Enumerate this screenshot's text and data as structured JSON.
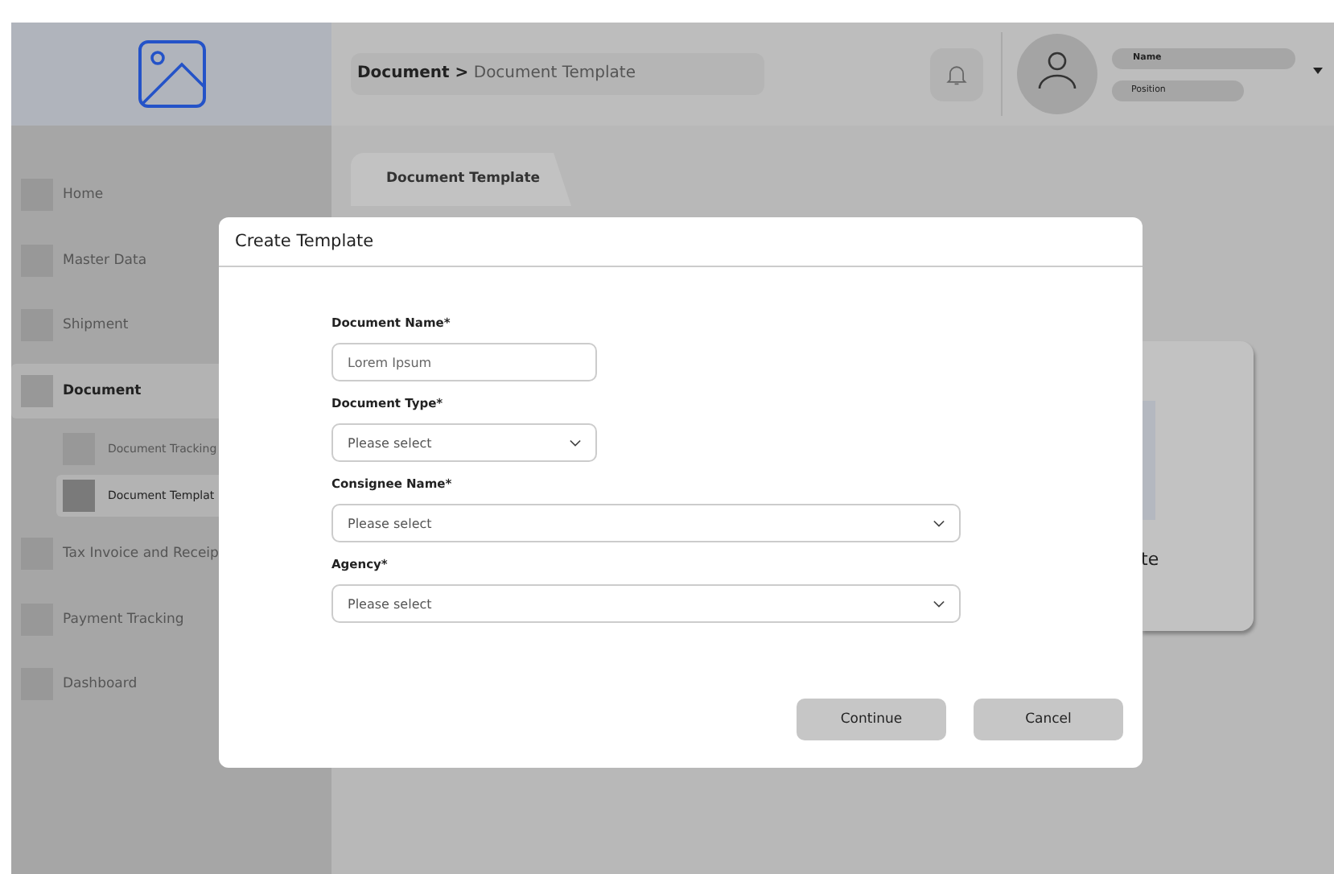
{
  "header": {
    "breadcrumb": "**Document >** Document Template",
    "user": {
      "name": "Name",
      "position": "Position"
    }
  },
  "sidebar": {
    "items": [
      {
        "label": "Home",
        "selected": false
      },
      {
        "label": "Master Data",
        "selected": false
      },
      {
        "label": "Shipment",
        "selected": false
      },
      {
        "label": "Document",
        "selected": true,
        "children": [
          {
            "label": "Document Tracking",
            "selected": false
          },
          {
            "label": "Document Templat",
            "selected": true
          }
        ]
      },
      {
        "label": "Tax Invoice and Receip",
        "selected": false
      },
      {
        "label": "Payment Tracking",
        "selected": false
      },
      {
        "label": "Dashboard",
        "selected": false
      }
    ]
  },
  "tabs": [
    {
      "label": "Document Template",
      "selected": true
    }
  ],
  "card": {
    "title": "te"
  },
  "dialog": {
    "title": "Create Template",
    "fields": [
      {
        "label": "Document Name*",
        "kind": "text",
        "placeholder": "Lorem Ipsum"
      },
      {
        "label": "Document Type*",
        "kind": "select",
        "placeholder": "Please select"
      },
      {
        "label": "Consignee Name*",
        "kind": "select",
        "placeholder": "Please select"
      },
      {
        "label": "Agency*",
        "kind": "select",
        "placeholder": "Please select"
      }
    ],
    "buttons": [
      "Continue",
      "Cancel"
    ]
  }
}
